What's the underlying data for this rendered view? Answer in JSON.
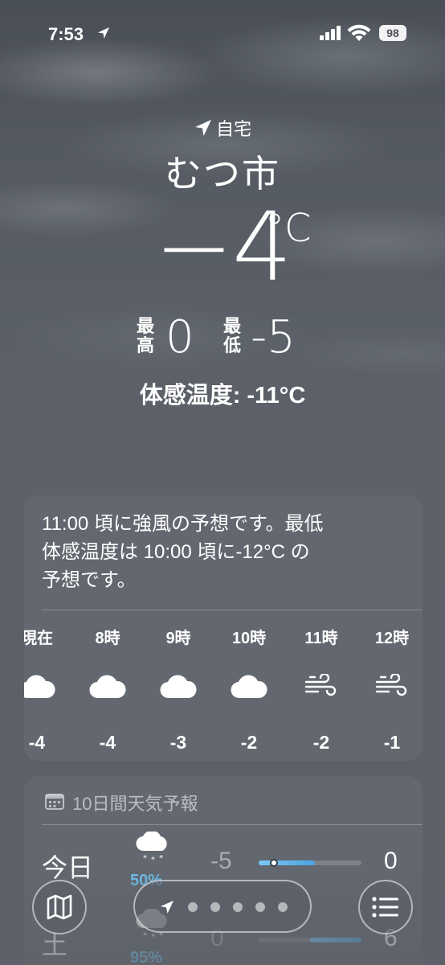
{
  "status_bar": {
    "time": "7:53",
    "battery": "98"
  },
  "location": {
    "label": "自宅",
    "city": "むつ市"
  },
  "current": {
    "temperature": "−4",
    "unit": "°C",
    "high_label": [
      "最",
      "高"
    ],
    "high": "0",
    "low_label": [
      "最",
      "低"
    ],
    "low": "-5",
    "feels_like": "体感温度: -11°C"
  },
  "hourly": {
    "alert_lines": [
      "11:00 頃に強風の予想です。最低",
      "体感温度は 10:00 頃に-12°C の",
      "予想です。"
    ],
    "items": [
      {
        "label": "現在",
        "icon": "cloud-icon",
        "temp": "-4"
      },
      {
        "label": "8時",
        "icon": "cloud-icon",
        "temp": "-4"
      },
      {
        "label": "9時",
        "icon": "cloud-icon",
        "temp": "-3"
      },
      {
        "label": "10時",
        "icon": "cloud-icon",
        "temp": "-2"
      },
      {
        "label": "11時",
        "icon": "wind-icon",
        "temp": "-2"
      },
      {
        "label": "12時",
        "icon": "wind-icon",
        "temp": "-1"
      }
    ]
  },
  "daily": {
    "title": "10日間天気予報",
    "days": [
      {
        "day": "今日",
        "icon": "snow-cloud-icon",
        "precip": "50%",
        "low": "-5",
        "high": "0",
        "bar_start": 0.0,
        "bar_end": 0.55,
        "current_marker": 0.15
      },
      {
        "day": "土",
        "icon": "snow-cloud-icon",
        "precip": "95%",
        "low": "0",
        "high": "6",
        "bar_start": 0.5,
        "bar_end": 1.0
      }
    ]
  },
  "toolbar": {
    "map_icon": "map-icon",
    "location_icon": "location-arrow-icon",
    "list_icon": "list-icon",
    "page_count": 5
  }
}
